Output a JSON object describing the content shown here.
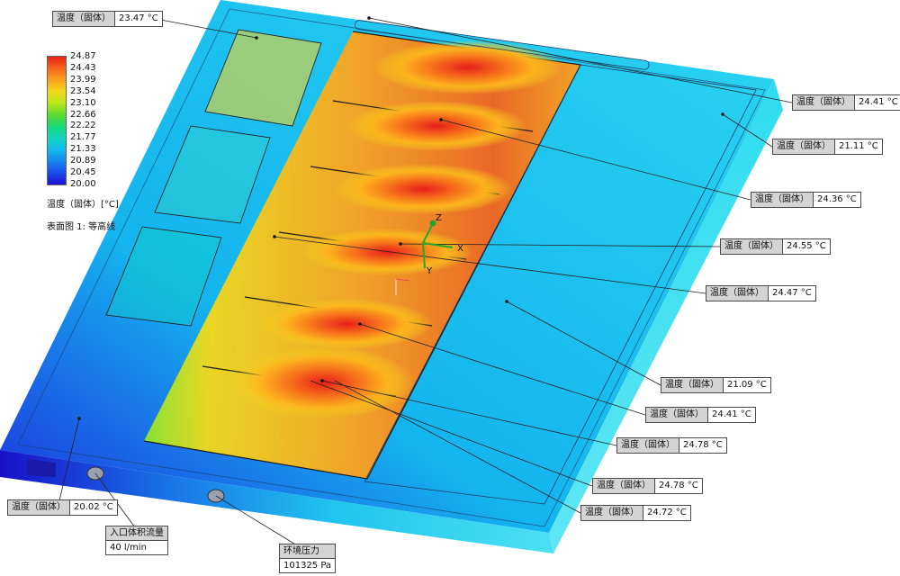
{
  "legend": {
    "ticks": [
      "24.87",
      "24.43",
      "23.99",
      "23.54",
      "23.10",
      "22.66",
      "22.22",
      "21.77",
      "21.33",
      "20.89",
      "20.45",
      "20.00"
    ],
    "colors": [
      "#e8231c",
      "#f5631b",
      "#fca01e",
      "#f4d91a",
      "#bfe619",
      "#5edc2c",
      "#17d77a",
      "#10d4c2",
      "#14b7ee",
      "#1884f0",
      "#1a4be8",
      "#1c12d8"
    ],
    "title": "温度（固体）[°C]",
    "plot_label": "表面图 1: 等高线"
  },
  "probes": [
    {
      "label": "温度（固体）",
      "value": "23.47 °C"
    },
    {
      "label": "温度（固体）",
      "value": "24.41 °C"
    },
    {
      "label": "温度（固体）",
      "value": "21.11 °C"
    },
    {
      "label": "温度（固体）",
      "value": "24.36 °C"
    },
    {
      "label": "温度（固体）",
      "value": "24.55 °C"
    },
    {
      "label": "温度（固体）",
      "value": "24.47 °C"
    },
    {
      "label": "温度（固体）",
      "value": "21.09 °C"
    },
    {
      "label": "温度（固体）",
      "value": "24.41 °C"
    },
    {
      "label": "温度（固体）",
      "value": "24.78 °C"
    },
    {
      "label": "温度（固体）",
      "value": "24.78 °C"
    },
    {
      "label": "温度（固体）",
      "value": "24.72 °C"
    },
    {
      "label": "温度（固体）",
      "value": "20.02 °C"
    }
  ],
  "boundary": {
    "inlet": {
      "label": "入口体积流量",
      "value": "40 l/min"
    },
    "ambient": {
      "label": "环境压力",
      "value": "101325 Pa"
    }
  },
  "triad": {
    "z": "Z",
    "x": "X",
    "y": "Y"
  },
  "colors": {
    "hot": "#e8231c",
    "warm": "#fca01e",
    "yellow": "#f4d91a",
    "green": "#5edc2c",
    "cyan": "#10d4c2",
    "plate": "#1aa4ec",
    "cold": "#1c12d8"
  }
}
